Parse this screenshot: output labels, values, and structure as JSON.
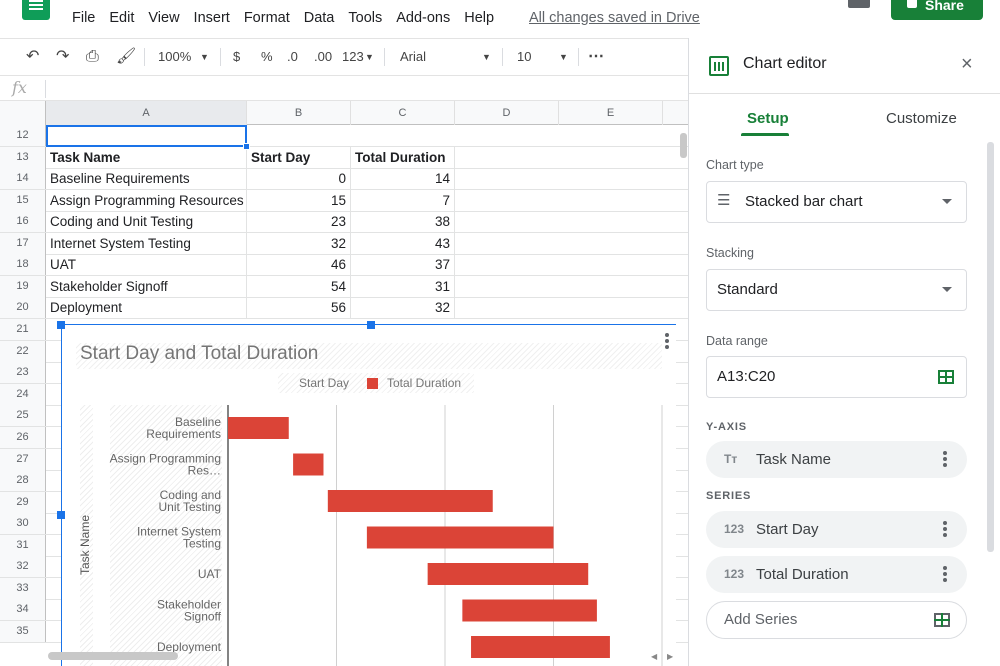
{
  "menu": {
    "items": [
      "File",
      "Edit",
      "View",
      "Insert",
      "Format",
      "Data",
      "Tools",
      "Add-ons",
      "Help"
    ],
    "saved_status": "All changes saved in Drive",
    "share_label": "Share"
  },
  "toolbar": {
    "zoom": "100%",
    "currency": "$",
    "percent": "%",
    "decrease_decimal": ".0",
    "increase_decimal": ".00",
    "number_format": "123",
    "font": "Arial",
    "font_size": "10",
    "more": "⋯"
  },
  "formula": {
    "fx": "fx"
  },
  "grid": {
    "columns": [
      "A",
      "B",
      "C",
      "D",
      "E"
    ],
    "row_numbers": [
      "12",
      "13",
      "14",
      "15",
      "16",
      "17",
      "18",
      "19",
      "20",
      "21",
      "22",
      "23",
      "24",
      "25",
      "26",
      "27",
      "28",
      "29",
      "30",
      "31",
      "32",
      "33",
      "34",
      "35"
    ],
    "headers": [
      "Task Name",
      "Start Day",
      "Total Duration"
    ],
    "rows": [
      [
        "Baseline Requirements",
        "0",
        "14"
      ],
      [
        "Assign Programming Resources",
        "15",
        "7"
      ],
      [
        "Coding and Unit Testing",
        "23",
        "38"
      ],
      [
        "Internet System Testing",
        "32",
        "43"
      ],
      [
        "UAT",
        "46",
        "37"
      ],
      [
        "Stakeholder Signoff",
        "54",
        "31"
      ],
      [
        "Deployment",
        "56",
        "32"
      ]
    ]
  },
  "chart_data": {
    "type": "bar",
    "orientation": "horizontal",
    "stacked": true,
    "title": "Start Day and Total Duration",
    "ylabel": "Task Name",
    "categories": [
      "Baseline Requirements",
      "Assign Programming Res…",
      "Coding and Unit Testing",
      "Internet System Testing",
      "UAT",
      "Stakeholder Signoff",
      "Deployment"
    ],
    "series": [
      {
        "name": "Start Day",
        "values": [
          0,
          15,
          23,
          32,
          46,
          54,
          56
        ],
        "color": "#ffffff",
        "visible": false
      },
      {
        "name": "Total Duration",
        "values": [
          14,
          7,
          38,
          43,
          37,
          31,
          32
        ],
        "color": "#db4437"
      }
    ],
    "xlim": [
      0,
      100
    ],
    "grid": true,
    "legend": "top"
  },
  "editor": {
    "title": "Chart editor",
    "close": "×",
    "tabs": [
      "Setup",
      "Customize"
    ],
    "chart_type_label": "Chart type",
    "chart_type_value": "Stacked bar chart",
    "stacking_label": "Stacking",
    "stacking_value": "Standard",
    "data_range_label": "Data range",
    "data_range_value": "A13:C20",
    "y_axis_label": "Y-AXIS",
    "y_axis_value": "Task Name",
    "y_axis_icon": "Tт",
    "series_label": "SERIES",
    "series": [
      {
        "icon": "123",
        "name": "Start Day"
      },
      {
        "icon": "123",
        "name": "Total Duration"
      }
    ],
    "add_series": "Add Series"
  }
}
